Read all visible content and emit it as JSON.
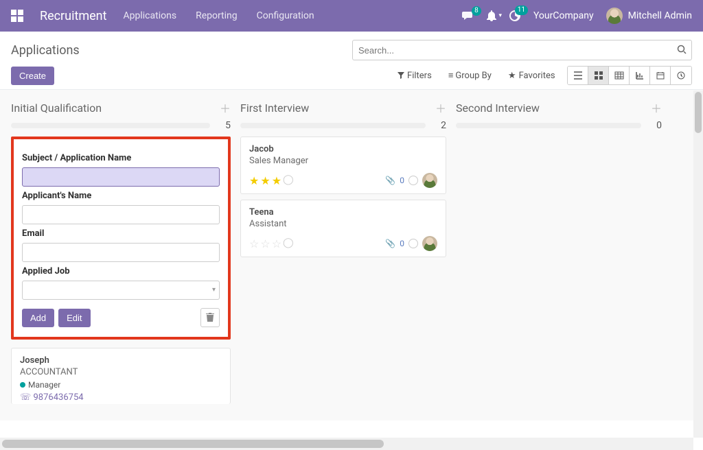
{
  "nav": {
    "brand": "Recruitment",
    "links": [
      "Applications",
      "Reporting",
      "Configuration"
    ],
    "messages_count": "8",
    "activities_count": "11",
    "company": "YourCompany",
    "user": "Mitchell Admin"
  },
  "page": {
    "title": "Applications",
    "create": "Create",
    "search_placeholder": "Search...",
    "filters": "Filters",
    "group_by": "Group By",
    "favorites": "Favorites"
  },
  "columns": [
    {
      "title": "Initial Qualification",
      "count": "5"
    },
    {
      "title": "First Interview",
      "count": "2"
    },
    {
      "title": "Second Interview",
      "count": "0"
    }
  ],
  "quick_create": {
    "subject_label": "Subject / Application Name",
    "applicant_label": "Applicant's Name",
    "email_label": "Email",
    "job_label": "Applied Job",
    "add": "Add",
    "edit": "Edit"
  },
  "first_interview_cards": [
    {
      "name": "Jacob",
      "sub": "Sales Manager",
      "stars": 3,
      "attachments": "0"
    },
    {
      "name": "Teena",
      "sub": "Assistant",
      "stars": 0,
      "attachments": "0"
    }
  ],
  "joseph": {
    "name": "Joseph",
    "sub": "ACCOUNTANT",
    "tag": "Manager",
    "phone": "9876436754"
  }
}
